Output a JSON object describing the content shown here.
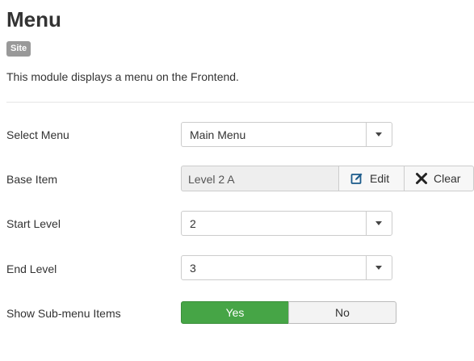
{
  "header": {
    "title": "Menu",
    "badge": "Site",
    "description": "This module displays a menu on the Frontend."
  },
  "form": {
    "select_menu": {
      "label": "Select Menu",
      "value": "Main Menu"
    },
    "base_item": {
      "label": "Base Item",
      "value": "Level 2 A",
      "edit_label": "Edit",
      "clear_label": "Clear"
    },
    "start_level": {
      "label": "Start Level",
      "value": "2"
    },
    "end_level": {
      "label": "End Level",
      "value": "3"
    },
    "show_submenu": {
      "label": "Show Sub-menu Items",
      "yes_label": "Yes",
      "no_label": "No",
      "selected": "Yes"
    }
  },
  "icons": {
    "edit": "edit-icon",
    "clear": "close-icon",
    "dropdown": "caret-down-icon"
  },
  "colors": {
    "badge": "#999999",
    "toggle_active": "#46a546",
    "text": "#333333"
  }
}
